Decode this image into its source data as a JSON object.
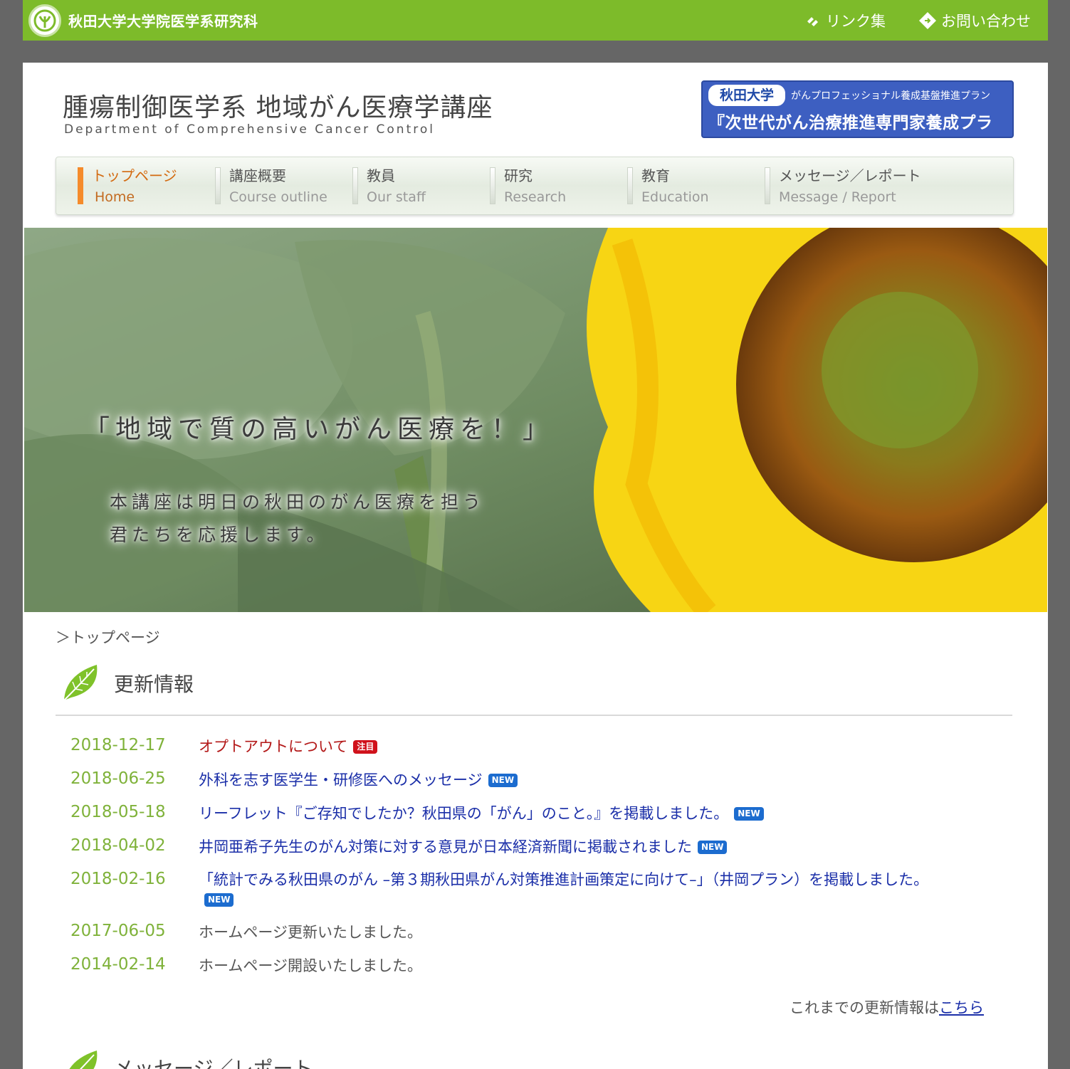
{
  "topbar": {
    "university": "秋田大学大学院医学系研究科",
    "links": [
      {
        "label": "リンク集"
      },
      {
        "label": "お問い合わせ"
      }
    ]
  },
  "header": {
    "title": "腫瘍制御医学系 地域がん医療学講座",
    "subtitle": "Department of Comprehensive Cancer Control",
    "banner": {
      "uni": "秋田大学",
      "plan": "がんプロフェッショナル養成基盤推進プラン",
      "main": "『次世代がん治療推進専門家養成プラン』"
    }
  },
  "nav": [
    {
      "jp": "トップページ",
      "en": "Home"
    },
    {
      "jp": "講座概要",
      "en": "Course outline"
    },
    {
      "jp": "教員",
      "en": "Our staff"
    },
    {
      "jp": "研究",
      "en": "Research"
    },
    {
      "jp": "教育",
      "en": "Education"
    },
    {
      "jp": "メッセージ／レポート",
      "en": "Message / Report"
    }
  ],
  "hero": {
    "title": "「地域で質の高いがん医療を！」",
    "line1": "本講座は明日の秋田のがん医療を担う",
    "line2": "君たちを応援します。"
  },
  "breadcrumb": "＞トップページ",
  "section": {
    "title": "更新情報"
  },
  "news": [
    {
      "date": "2018-12-17",
      "text": "オプトアウトについて",
      "badge": "注目"
    },
    {
      "date": "2018-06-25",
      "text": "外科を志す医学生・研修医へのメッセージ",
      "badge": "NEW"
    },
    {
      "date": "2018-05-18",
      "text": "リーフレット『ご存知でしたか？秋田県の「がん」のこと。』を掲載しました。",
      "badge": "NEW"
    },
    {
      "date": "2018-04-02",
      "text": "井岡亜希子先生のがん対策に対する意見が日本経済新聞に掲載されました",
      "badge": "NEW"
    },
    {
      "date": "2018-02-16",
      "text": "「統計でみる秋田県のがん –第３期秋田県がん対策推進計画策定に向けて–」（井岡プラン）を掲載しました。",
      "badge": "NEW"
    },
    {
      "date": "2017-06-05",
      "text": "ホームページ更新いたしました。"
    },
    {
      "date": "2014-02-14",
      "text": "ホームページ開設いたしました。"
    }
  ],
  "more": {
    "prefix": "これまでの更新情報は",
    "link": "こちら"
  },
  "next_section": {
    "title": "メッセージ／レポート"
  },
  "colors": {
    "topbar": "#7dbb2a",
    "accent_orange": "#f58b2b",
    "date_green": "#7fb23a",
    "link_blue": "#1a2ea8",
    "banner_blue": "#3d5fc1"
  }
}
